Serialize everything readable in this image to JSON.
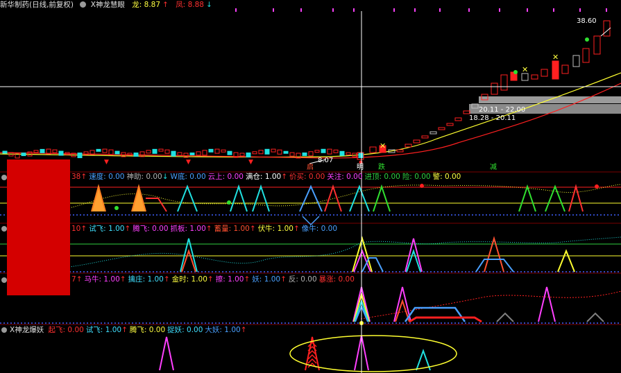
{
  "header": {
    "title": "新华制药(日线,前复权)",
    "indicator": "X神龙慧眼",
    "dragon_label": "龙: 8.87",
    "dragon_arrow": "↑",
    "phoenix_label": "凤: 8.88",
    "phoenix_arrow": "↓"
  },
  "main_chart": {
    "high_price_label": "38.60",
    "band1_label": "20.11 - 22.00",
    "band2_label": "18.28 - 20.11",
    "low_price_label": "8.07",
    "markers": [
      "启",
      "明",
      "跌",
      "减"
    ]
  },
  "panel1": {
    "items": [
      {
        "text": "38",
        "arrow": "↑",
        "color": "#ff3030"
      },
      {
        "text": "速度: 0.00",
        "arrow": "",
        "color": "#4aa0ff"
      },
      {
        "text": "神助: 0.00",
        "arrow": "↓",
        "color": "#b0b0b0"
      },
      {
        "text": "W底: 0.00",
        "arrow": "",
        "color": "#4aa0ff"
      },
      {
        "text": "云上: 0.00",
        "arrow": "",
        "color": "#ff40ff"
      },
      {
        "text": "满仓: 1.00",
        "arrow": "↑",
        "color": "#ffffff"
      },
      {
        "text": "价买: 0.00",
        "arrow": "",
        "color": "#ff3030"
      },
      {
        "text": "关注: 0.00",
        "arrow": "",
        "color": "#ff40ff"
      },
      {
        "text": "进顶: 0.00",
        "arrow": "",
        "color": "#30d040"
      },
      {
        "text": "险: 0.00",
        "arrow": "",
        "color": "#30d040"
      },
      {
        "text": "警: 0.00",
        "arrow": "",
        "color": "#ffff40"
      }
    ]
  },
  "panel2": {
    "items": [
      {
        "text": "10",
        "arrow": "↑",
        "color": "#ff3030"
      },
      {
        "text": "试飞: 1.00",
        "arrow": "↑",
        "color": "#40e0ff"
      },
      {
        "text": "腾飞: 0.00",
        "arrow": "",
        "color": "#ff40ff"
      },
      {
        "text": "抓板: 1.00",
        "arrow": "↑",
        "color": "#ff40ff"
      },
      {
        "text": "蓄量: 1.00",
        "arrow": "↑",
        "color": "#ff5030"
      },
      {
        "text": "伏牛: 1.00",
        "arrow": "↑",
        "color": "#ffff40"
      },
      {
        "text": "像牛: 0.00",
        "arrow": "",
        "color": "#4aa0ff"
      }
    ]
  },
  "panel3": {
    "items": [
      {
        "text": "7",
        "arrow": "↑",
        "color": "#ff3030"
      },
      {
        "text": "马牛: 1.00",
        "arrow": "↑",
        "color": "#ff40ff"
      },
      {
        "text": "擒庄: 1.00",
        "arrow": "↑",
        "color": "#40e0ff"
      },
      {
        "text": "金时: 1.00",
        "arrow": "↑",
        "color": "#ffff40"
      },
      {
        "text": "擦: 1.00",
        "arrow": "↑",
        "color": "#ff40ff"
      },
      {
        "text": "妖: 1.00",
        "arrow": "↑",
        "color": "#4aa0ff"
      },
      {
        "text": "反: 0.00",
        "arrow": "",
        "color": "#b0b0b0"
      },
      {
        "text": "暴涨: 0.00",
        "arrow": "",
        "color": "#ff3030"
      }
    ]
  },
  "panel4": {
    "title": "X神龙爆妖",
    "items": [
      {
        "text": "起飞: 0.00",
        "arrow": "",
        "color": "#ff3030"
      },
      {
        "text": "试飞: 1.00",
        "arrow": "↑",
        "color": "#40e0ff"
      },
      {
        "text": "腾飞: 0.00",
        "arrow": "",
        "color": "#ffff40"
      },
      {
        "text": "捉妖: 0.00",
        "arrow": "",
        "color": "#40e0ff"
      },
      {
        "text": "大妖: 1.00",
        "arrow": "↑",
        "color": "#4aa0ff"
      }
    ]
  },
  "colors": {
    "up": "#ff2020",
    "down": "#20e0e0",
    "ma_yellow": "#ffff30",
    "ma_red": "#ff2020",
    "crosshair": "#ffffff",
    "separator": "#7a0000"
  }
}
